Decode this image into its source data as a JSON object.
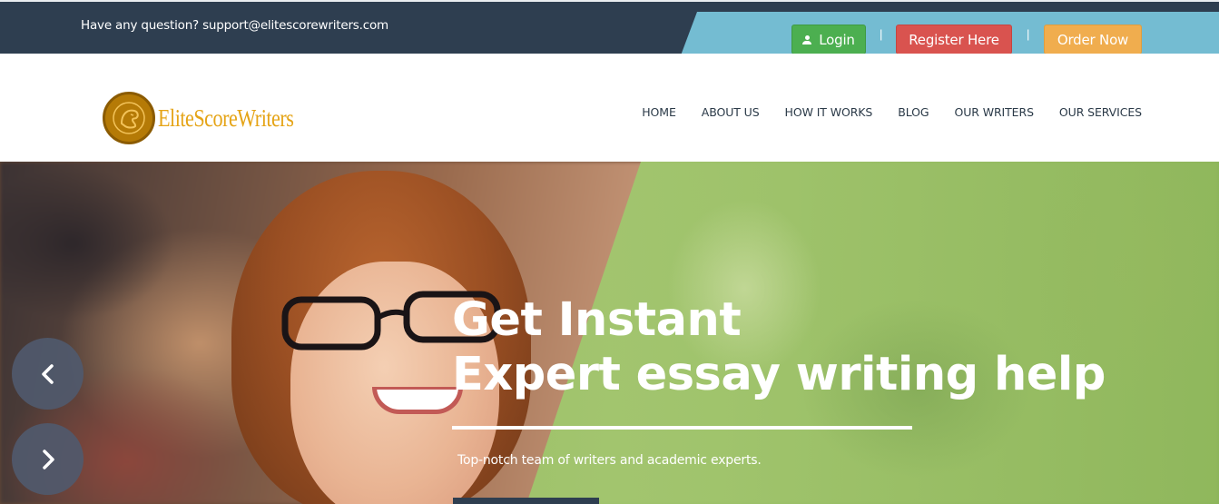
{
  "topbar": {
    "question": "Have any question? support@elitescorewriters.com",
    "login_label": "Login",
    "register_label": "Register Here",
    "order_label": "Order Now",
    "separator": "|"
  },
  "logo": {
    "text": "EliteScoreWriters"
  },
  "nav": {
    "items": [
      "HOME",
      "ABOUT US",
      "HOW IT WORKS",
      "BLOG",
      "OUR WRITERS",
      "OUR SERVICES"
    ]
  },
  "hero": {
    "heading_line1": "Get Instant",
    "heading_line2": "Expert essay writing help",
    "subtitle": "Top-notch team of writers and academic experts."
  },
  "colors": {
    "topbar_bg": "#2e3e50",
    "accent_blue": "#74bcd2",
    "login_green": "#4caf50",
    "register_red": "#d9534f",
    "order_orange": "#f0ad4e",
    "logo_gold": "#e5a416"
  },
  "icons": {
    "login": "user-icon",
    "prev": "chevron-left-icon",
    "next": "chevron-right-icon",
    "logo": "lion-head-icon"
  }
}
